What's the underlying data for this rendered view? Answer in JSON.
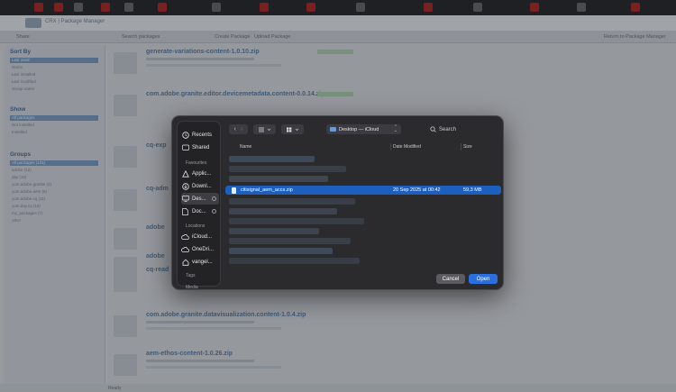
{
  "browser": {
    "url_text": "CRX | Package Manager"
  },
  "app": {
    "toolbar": {
      "share": "Share",
      "search_placeholder": "Search packages",
      "create": "Create Package",
      "upload": "Upload Package",
      "right": "Return to Package Manager"
    },
    "left_panel": {
      "sort_title": "Sort By",
      "sort_items": [
        "Last used",
        "Name",
        "Last installed",
        "Last modified",
        "Group name"
      ],
      "show_title": "Show",
      "show_items": [
        "All packages",
        "Not installed",
        "Installed"
      ],
      "groups_title": "Groups",
      "group_items": [
        "All packages (101)",
        "adobe (12)",
        "day (15)",
        "com.adobe.granite (4)",
        "com.adobe.aem (9)",
        "com.adobe.cq (11)",
        "com.day.cq (18)",
        "my_packages (7)",
        "other"
      ]
    },
    "packages": [
      {
        "title": "generate-variations-content-1.0.10.zip"
      },
      {
        "title": "com.adobe.granite.editor.devicemetadata.content-0.0.14.zip"
      },
      {
        "title": "cq-exp"
      },
      {
        "title": "cq-adm"
      },
      {
        "title": "adobe"
      },
      {
        "title": "adobe"
      },
      {
        "title": "cq-read"
      },
      {
        "title": "com.adobe.granite.datavisualization.content-1.0.4.zip"
      },
      {
        "title": "aem-ethos-content-1.0.26.zip"
      }
    ],
    "status": "Ready"
  },
  "dialog": {
    "sidebar": {
      "recents": "Recents",
      "shared": "Shared",
      "favourites_head": "Favourites",
      "favourites": [
        "Applic...",
        "Downl...",
        "Des...",
        "Doc..."
      ],
      "locations_head": "Locations",
      "locations": [
        "iCloud...",
        "OneDri...",
        "vangel..."
      ],
      "tags_head": "Tags",
      "media_head": "Media"
    },
    "location": "Desktop — iCloud",
    "search_label": "Search",
    "columns": {
      "name": "Name",
      "date": "Date Modified",
      "size": "Size"
    },
    "selected_file": {
      "name": "citisignal_aem_accs.zip",
      "date": "20 Sep 2025 at 00:42",
      "size": "59,3 MB"
    },
    "cancel_label": "Cancel",
    "open_label": "Open"
  },
  "colors": {
    "accent": "#2a6fe0",
    "selection": "#1c5fbf",
    "dialog_bg": "#2b2b2e"
  }
}
